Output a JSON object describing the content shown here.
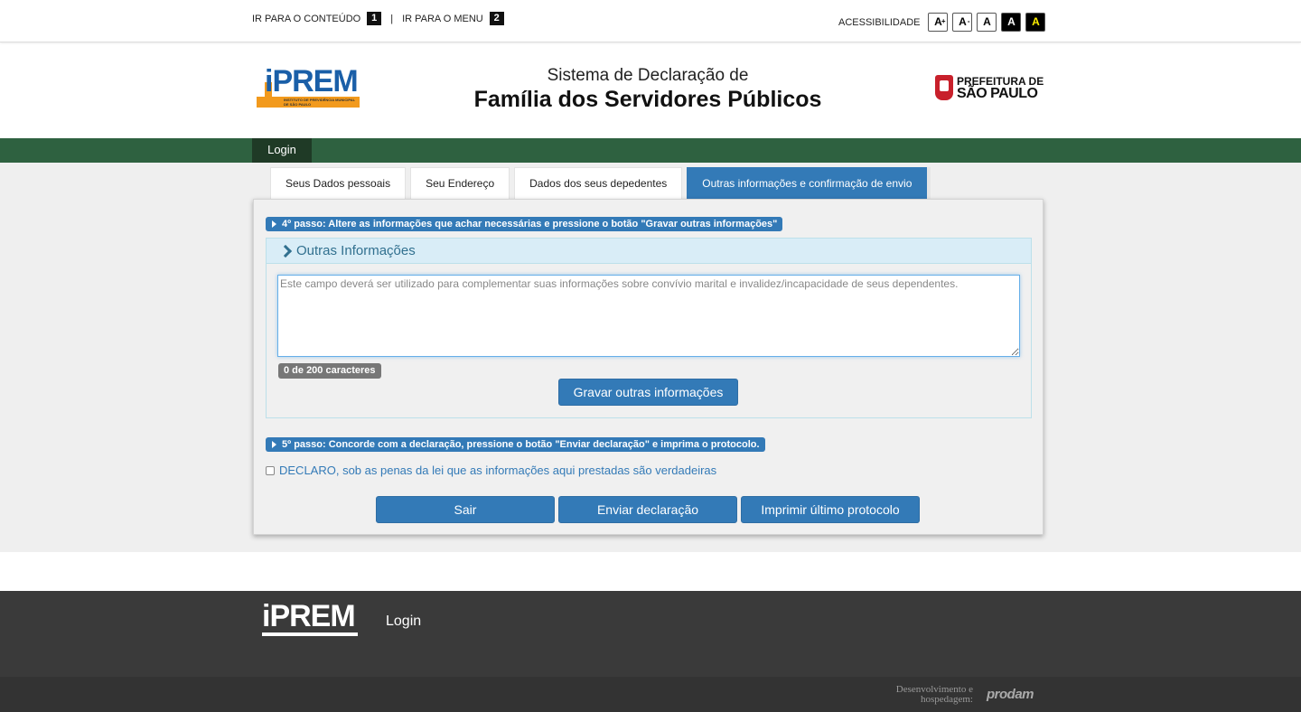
{
  "skiplinks": {
    "content_label": "IR PARA O CONTEÚDO",
    "content_key": "1",
    "separator": "|",
    "menu_label": "IR PARA O MENU",
    "menu_key": "2"
  },
  "accessibility": {
    "label": "ACESSIBILIDADE",
    "buttons": [
      {
        "label": "A",
        "sup": "+"
      },
      {
        "label": "A",
        "sup": "-"
      },
      {
        "label": "A"
      },
      {
        "label": "A"
      },
      {
        "label": "A"
      }
    ]
  },
  "header": {
    "logo_text": "iPREM",
    "logo_subtext": "INSTITUTO DE PREVIDÊNCIA MUNICIPAL DE SÃO PAULO",
    "title_sub": "Sistema de Declaração de",
    "title_main": "Família dos Servidores Públicos",
    "city_logo_line1": "PREFEITURA DE",
    "city_logo_line2": "SÃO PAULO"
  },
  "nav": {
    "login": "Login"
  },
  "tabs": [
    {
      "label": "Seus Dados pessoais"
    },
    {
      "label": "Seu Endereço"
    },
    {
      "label": "Dados dos seus depedentes"
    },
    {
      "label": "Outras informações e confirmação de envio"
    }
  ],
  "step4": {
    "label": "4º passo: Altere as informações que achar necessárias e pressione o botão \"Gravar outras informações\""
  },
  "other_info": {
    "heading": "Outras Informações",
    "textarea_value": "",
    "textarea_placeholder": "Este campo deverá ser utilizado para complementar suas informações sobre convívio marital e invalidez/incapacidade de seus dependentes.",
    "counter": "0 de 200 caracteres",
    "save_button": "Gravar outras informações"
  },
  "step5": {
    "label": "5º passo: Concorde com a declaração, pressione o botão \"Enviar declaração\" e imprima o protocolo."
  },
  "declaration": {
    "checked": false,
    "label": "DECLARO, sob as penas da lei que as informações aqui prestadas são verdadeiras"
  },
  "actions": {
    "exit": "Sair",
    "send": "Enviar declaração",
    "print": "Imprimir último protocolo"
  },
  "footer": {
    "logo_text": "iPREM",
    "login": "Login",
    "dev_line1": "Desenvolvimento e",
    "dev_line2": "hospedagem:",
    "vendor": "prodam"
  },
  "colors": {
    "primary": "#337ab7",
    "green_bar": "#2e6140",
    "green_tab": "#1f3a26",
    "footer": "#3a3a3a",
    "logo_orange": "#f29a1d",
    "logo_blue": "#1a5fa8",
    "city_red": "#c8202b"
  }
}
